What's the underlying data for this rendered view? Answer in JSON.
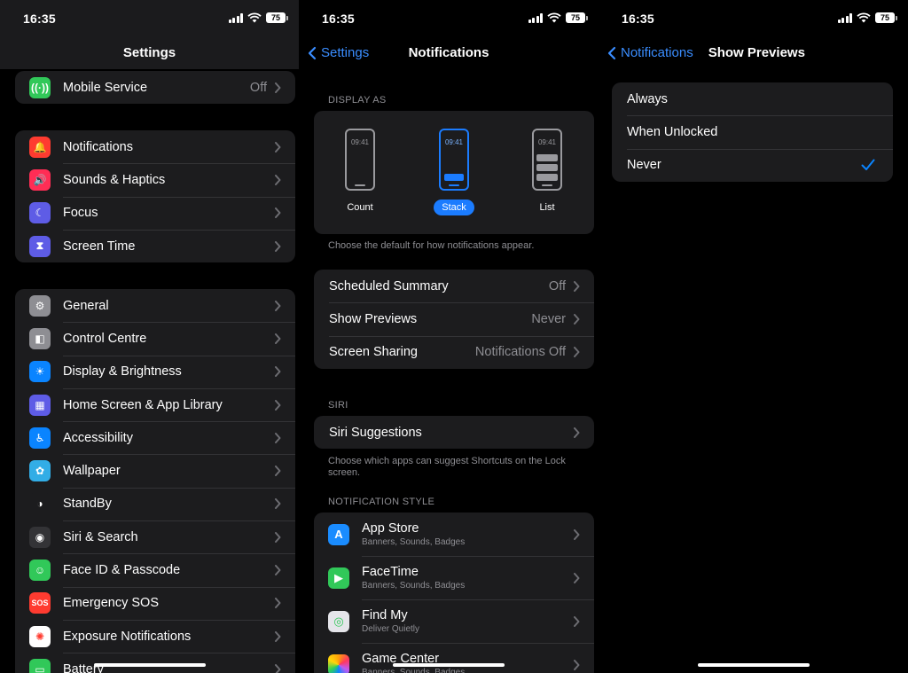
{
  "colors": {
    "accent": "#0a84ff",
    "background": "#000000",
    "cell": "#1c1c1e",
    "secondary_text": "#8e8e93"
  },
  "screen1": {
    "time": "16:35",
    "battery": "75",
    "title": "Settings",
    "group0": [
      {
        "label": "Mobile Service",
        "value": "Off",
        "icon": "antenna-icon",
        "color": "#31c859"
      }
    ],
    "group1": [
      {
        "label": "Notifications",
        "icon": "bell-icon",
        "color": "#ff3b30"
      },
      {
        "label": "Sounds & Haptics",
        "icon": "speaker-icon",
        "color": "#ff2d55"
      },
      {
        "label": "Focus",
        "icon": "moon-icon",
        "color": "#5e5ce6"
      },
      {
        "label": "Screen Time",
        "icon": "hourglass-icon",
        "color": "#5e5ce6"
      }
    ],
    "group2": [
      {
        "label": "General",
        "icon": "gear-icon",
        "color": "#8e8e93"
      },
      {
        "label": "Control Centre",
        "icon": "toggles-icon",
        "color": "#8e8e93"
      },
      {
        "label": "Display & Brightness",
        "icon": "sun-icon",
        "color": "#0a84ff"
      },
      {
        "label": "Home Screen & App Library",
        "icon": "grid-icon",
        "color": "#5e5ce6"
      },
      {
        "label": "Accessibility",
        "icon": "accessibility-icon",
        "color": "#0a84ff"
      },
      {
        "label": "Wallpaper",
        "icon": "flower-icon",
        "color": "#32ade6"
      },
      {
        "label": "StandBy",
        "icon": "standby-icon",
        "color": "#1c1c1e"
      },
      {
        "label": "Siri & Search",
        "icon": "siri-icon",
        "color": "#333336"
      },
      {
        "label": "Face ID & Passcode",
        "icon": "faceid-icon",
        "color": "#31c859"
      },
      {
        "label": "Emergency SOS",
        "icon": "sos-icon",
        "color": "#ff3b30"
      },
      {
        "label": "Exposure Notifications",
        "icon": "exposure-icon",
        "color": "#ffffff"
      },
      {
        "label": "Battery",
        "icon": "battery-icon",
        "color": "#31c859"
      }
    ]
  },
  "screen2": {
    "time": "16:35",
    "battery": "75",
    "back_label": "Settings",
    "title": "Notifications",
    "display_as_header": "DISPLAY AS",
    "display_options": [
      {
        "label": "Count",
        "clock": "09:41",
        "selected": false
      },
      {
        "label": "Stack",
        "clock": "09:41",
        "selected": true
      },
      {
        "label": "List",
        "clock": "09:41",
        "selected": false
      }
    ],
    "display_footnote": "Choose the default for how notifications appear.",
    "settings_rows": [
      {
        "label": "Scheduled Summary",
        "value": "Off"
      },
      {
        "label": "Show Previews",
        "value": "Never"
      },
      {
        "label": "Screen Sharing",
        "value": "Notifications Off"
      }
    ],
    "siri_header": "SIRI",
    "siri_row": "Siri Suggestions",
    "siri_footnote": "Choose which apps can suggest Shortcuts on the Lock screen.",
    "style_header": "NOTIFICATION STYLE",
    "apps": [
      {
        "name": "App Store",
        "sub": "Banners, Sounds, Badges",
        "icon": "appstore-icon",
        "color": "#1a8cff"
      },
      {
        "name": "FaceTime",
        "sub": "Banners, Sounds, Badges",
        "icon": "facetime-icon",
        "color": "#31c859"
      },
      {
        "name": "Find My",
        "sub": "Deliver Quietly",
        "icon": "findmy-icon",
        "color": "#31c859"
      },
      {
        "name": "Game Center",
        "sub": "Banners, Sounds, Badges",
        "icon": "gamecenter-icon",
        "color": "#ff9f0a"
      }
    ]
  },
  "screen3": {
    "time": "16:35",
    "battery": "75",
    "back_label": "Notifications",
    "title": "Show Previews",
    "options": [
      {
        "label": "Always",
        "checked": false
      },
      {
        "label": "When Unlocked",
        "checked": false
      },
      {
        "label": "Never",
        "checked": true
      }
    ]
  }
}
